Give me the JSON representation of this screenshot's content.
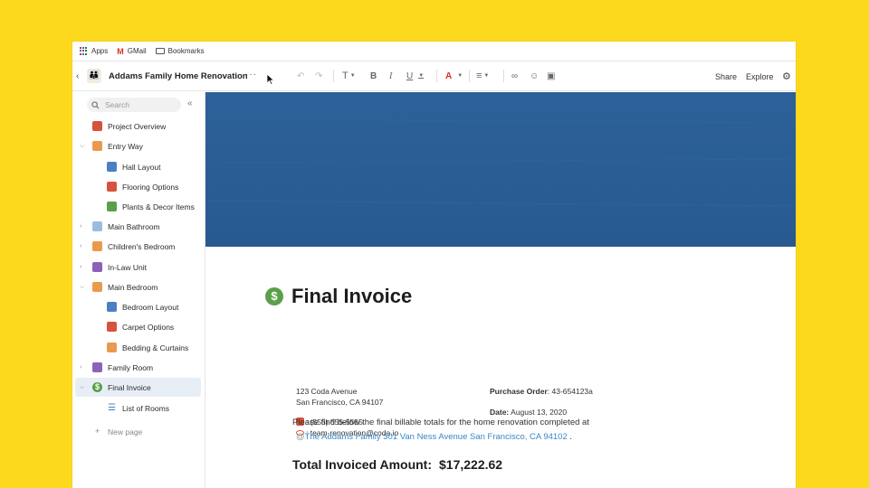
{
  "bookmarks": {
    "apps": "Apps",
    "gmail": "GMail",
    "bookmarks": "Bookmarks"
  },
  "toolbar": {
    "doc_title": "Addams Family Home Renovation",
    "more": "···",
    "text_style": "T",
    "bold": "B",
    "italic": "I",
    "underline": "U",
    "font_color": "A",
    "share": "Share",
    "explore": "Explore"
  },
  "sidebar": {
    "search_placeholder": "Search",
    "items": [
      {
        "label": "Project Overview"
      },
      {
        "label": "Entry Way"
      },
      {
        "label": "Hall Layout"
      },
      {
        "label": "Flooring Options"
      },
      {
        "label": "Plants & Decor Items"
      },
      {
        "label": "Main Bathroom"
      },
      {
        "label": "Children's Bedroom"
      },
      {
        "label": "In-Law Unit"
      },
      {
        "label": "Main Bedroom"
      },
      {
        "label": "Bedroom Layout"
      },
      {
        "label": "Carpet Options"
      },
      {
        "label": "Bedding & Curtains"
      },
      {
        "label": "Family Room"
      },
      {
        "label": "Final Invoice"
      },
      {
        "label": "List of Rooms"
      }
    ],
    "new_page": "New page"
  },
  "invoice": {
    "title": "Final Invoice",
    "address_line1": "123 Coda Avenue",
    "address_line2": "San Francisco, CA 94107",
    "phone": ": (555) 555-5555",
    "email": ":  team-renovation@coda.io",
    "po_label": "Purchase Order",
    "po_value": ": 43-654123a",
    "date_label": "Date:",
    "date_value": " August 13, 2020",
    "description": "Please find below the final billable totals for the home renovation completed at",
    "mention_at": "@",
    "mention_link": "The Addams Family 301 Van Ness Avenue San Francisco, CA 94102",
    "mention_period": " .",
    "total_label": "Total Invoiced Amount:",
    "total_value": "$17,222.62"
  },
  "colors": {
    "background": "#FDD91E",
    "banner": "#2B5F97",
    "accent_link": "#3A86C8",
    "invoice_icon": "#5AA048",
    "active_item": "#E8EEF5"
  }
}
